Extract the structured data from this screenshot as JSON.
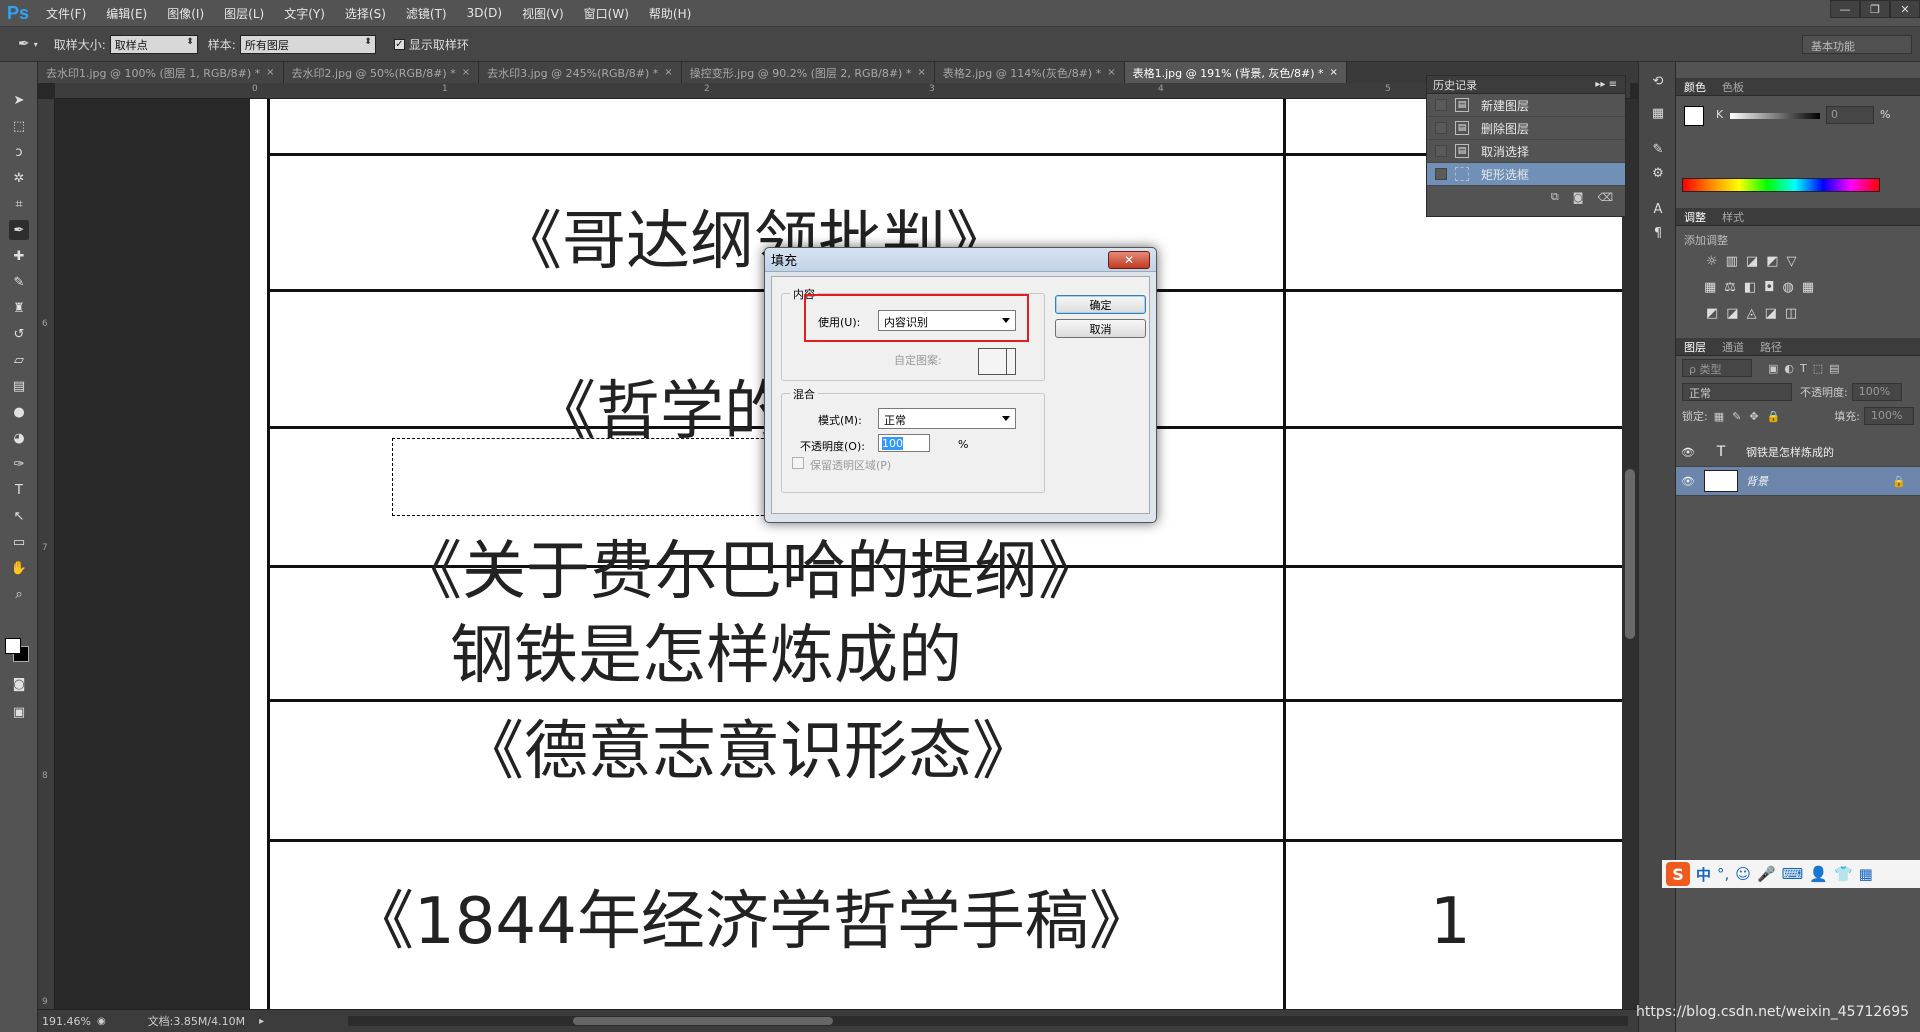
{
  "app": {
    "logo": "Ps",
    "menu": [
      "文件(F)",
      "编辑(E)",
      "图像(I)",
      "图层(L)",
      "文字(Y)",
      "选择(S)",
      "滤镜(T)",
      "3D(D)",
      "视图(V)",
      "窗口(W)",
      "帮助(H)"
    ],
    "window_controls": [
      "—",
      "❐",
      "✕"
    ]
  },
  "options_bar": {
    "sample_size_label": "取样大小:",
    "sample_size_value": "取样点",
    "sample_label": "样本:",
    "sample_value": "所有图层",
    "show_ring_check": "✓",
    "show_ring_label": "显示取样环",
    "workspace": "基本功能"
  },
  "tabs": [
    {
      "label": "去水印1.jpg @ 100% (图层 1, RGB/8#) *",
      "active": false
    },
    {
      "label": "去水印2.jpg @ 50%(RGB/8#) *",
      "active": false
    },
    {
      "label": "去水印3.jpg @ 245%(RGB/8#) *",
      "active": false
    },
    {
      "label": "操控变形.jpg @ 90.2% (图层 2, RGB/8#) *",
      "active": false
    },
    {
      "label": "表格2.jpg @ 114%(灰色/8#) *",
      "active": false
    },
    {
      "label": "表格1.jpg @ 191% (背景, 灰色/8#) *",
      "active": true
    }
  ],
  "tab_close": "×",
  "ruler": {
    "top_ticks": [
      "0",
      "1",
      "2",
      "3",
      "4",
      "5"
    ],
    "left_ticks": [
      "6",
      "7",
      "8",
      "9"
    ]
  },
  "document": {
    "rows": [
      "《哥达纲领批判》",
      "《哲学的",
      "《关于费尔巴哈的提纲》",
      "钢铁是怎样炼成的",
      "《德意志意识形态》",
      "《1844年经济学哲学手稿》"
    ],
    "right_col_value": "1"
  },
  "status": {
    "zoom": "191.46%",
    "doc_size": "文档:3.85M/4.10M"
  },
  "history": {
    "title": "历史记录",
    "items": [
      {
        "label": "新建图层",
        "active": false
      },
      {
        "label": "删除图层",
        "active": false
      },
      {
        "label": "取消选择",
        "active": false
      },
      {
        "label": "矩形选框",
        "active": true
      }
    ]
  },
  "color_panel": {
    "tabs": [
      "颜色",
      "色板"
    ],
    "channel_label": "K",
    "channel_value": "0",
    "percent": "%"
  },
  "adjust_panel": {
    "tabs": [
      "调整",
      "样式"
    ],
    "add_label": "添加调整"
  },
  "layers_panel": {
    "tabs": [
      "图层",
      "通道",
      "路径"
    ],
    "filter_label": "ρ 类型",
    "blend_mode": "正常",
    "opacity_label": "不透明度:",
    "opacity_value": "100%",
    "lock_label": "锁定:",
    "fill_label": "填充:",
    "fill_value": "100%",
    "layers": [
      {
        "name": "钢铁是怎样炼成的",
        "type": "text",
        "active": false
      },
      {
        "name": "背景",
        "type": "image",
        "active": true
      }
    ]
  },
  "ime": {
    "logo": "S",
    "mode": "中",
    "punct": "°,"
  },
  "watermark": "https://blog.csdn.net/weixin_45712695",
  "fill_dialog": {
    "title": "填充",
    "close": "✕",
    "content_group": "内容",
    "use_label": "使用(U):",
    "use_value": "内容识别",
    "custom_pattern_label": "自定图案:",
    "blend_group": "混合",
    "mode_label": "模式(M):",
    "mode_value": "正常",
    "opacity_label": "不透明度(O):",
    "opacity_value": "100",
    "opacity_unit": "%",
    "preserve_label": "保留透明区域(P)",
    "ok": "确定",
    "cancel": "取消"
  }
}
